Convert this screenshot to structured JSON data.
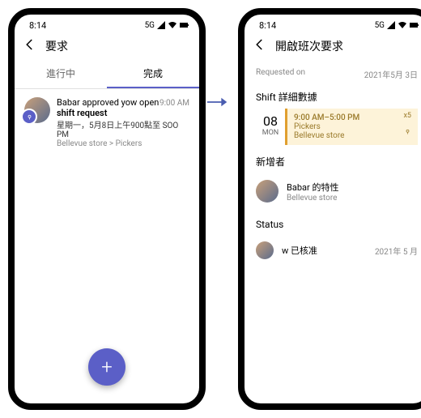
{
  "statusbar": {
    "time": "8:14",
    "network": "5G"
  },
  "left": {
    "title": "要求",
    "tabs": {
      "inprogress": "進行中",
      "done": "完成"
    },
    "item": {
      "line1": "Babar approved yow open",
      "line2": "shift request",
      "line3": "星期一，5月8日上午900點至 SOO PM",
      "line4": "Bellevue store > Pickers",
      "time": "9:00 AM"
    },
    "fab": "+"
  },
  "right": {
    "title": "開啟班次要求",
    "requested_label": "Requested on",
    "requested_date": "2021年5月 3日",
    "shift_section": "Shift 詳細數據",
    "shift": {
      "day": "08",
      "dow": "MON",
      "time": "9:00 AM–5:00 PM",
      "group": "Pickers",
      "store": "Bellevue store",
      "count": "x5"
    },
    "added_by_label": "新增者",
    "added_by": {
      "name": "Babar 的特性",
      "store": "Bellevue store"
    },
    "status_label": "Status",
    "status": {
      "text": "w 已核准",
      "date": "2021年 5 月"
    }
  }
}
